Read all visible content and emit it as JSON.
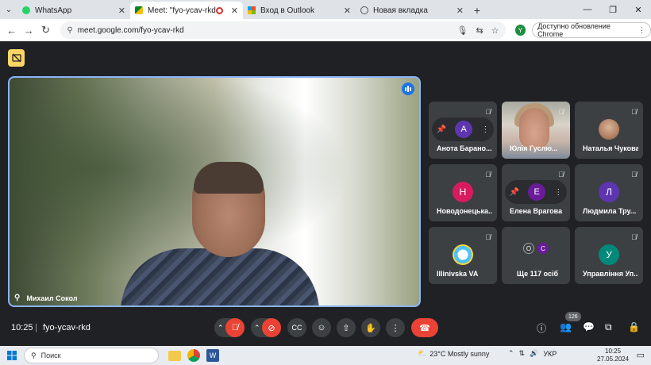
{
  "browser": {
    "tabs": [
      {
        "title": "WhatsApp",
        "active": false
      },
      {
        "title": "Meet: \"fyo-ycav-rkd\"",
        "active": true
      },
      {
        "title": "Вход в Outlook",
        "active": false
      },
      {
        "title": "Новая вкладка",
        "active": false
      }
    ],
    "url": "meet.google.com/fyo-ycav-rkd",
    "profile_initial": "Y",
    "update_label": "Доступно обновление Chrome"
  },
  "meet": {
    "main": {
      "name": "Михаил Сокол"
    },
    "tiles": [
      {
        "name": "Анота Барано...",
        "avatar": "А",
        "avatar_color": "#5e35b1"
      },
      {
        "name": "Юлія Гуслю...",
        "avatar": "",
        "avatar_color": ""
      },
      {
        "name": "Наталья Чукова",
        "avatar": "",
        "avatar_color": ""
      },
      {
        "name": "Новодонецька...",
        "avatar": "Н",
        "avatar_color": "#d81b60"
      },
      {
        "name": "Елена Врагова",
        "avatar": "Е",
        "avatar_color": "#6a1b9a"
      },
      {
        "name": "Людмила Тру...",
        "avatar": "Л",
        "avatar_color": "#5e35b1"
      },
      {
        "name": "Illinivska VA",
        "avatar": "",
        "avatar_color": ""
      },
      {
        "name": "Ще 117 осіб",
        "avatar": "",
        "avatar_color": ""
      },
      {
        "name": "Управління Уп...",
        "avatar": "У",
        "avatar_color": "#00897b"
      }
    ],
    "others_avatars": [
      "O",
      "C"
    ],
    "controls": {
      "time": "10:25",
      "separator": "|",
      "meeting_code": "fyo-ycav-rkd",
      "participants_count": "126"
    }
  },
  "taskbar": {
    "search_placeholder": "Поиск",
    "weather": "23°C  Mostly sunny",
    "language": "УКР",
    "time": "10:25",
    "date": "27.05.2024"
  }
}
